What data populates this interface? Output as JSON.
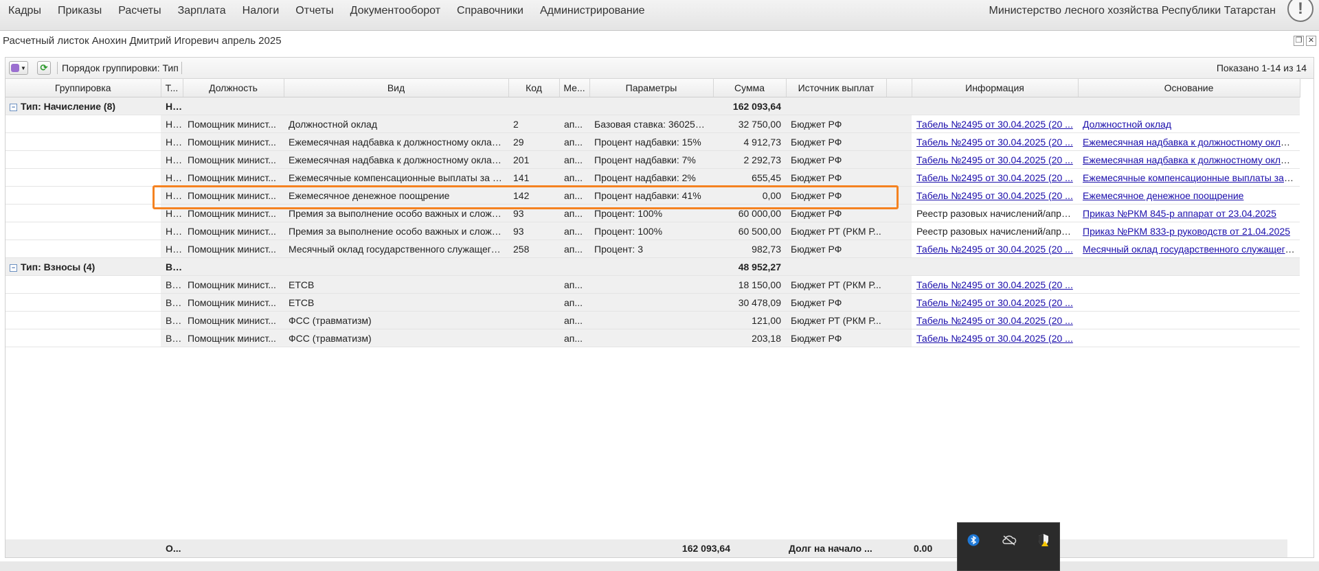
{
  "menu": [
    "Кадры",
    "Приказы",
    "Расчеты",
    "Зарплата",
    "Налоги",
    "Отчеты",
    "Документооборот",
    "Справочники",
    "Администрирование"
  ],
  "org_name": "Министерство лесного хозяйства Республики Татарстан",
  "alert_icon": "!",
  "window_title": "Расчетный листок Анохин Дмитрий Игоревич апрель 2025",
  "toolbar": {
    "group_order": "Порядок группировки:  Тип",
    "shown": "Показано 1-14 из 14"
  },
  "columns": [
    "Группировка",
    "Т...",
    "Должность",
    "Вид",
    "Код",
    "Ме...",
    "Параметры",
    "Сумма",
    "Источник выплат",
    "",
    "Информация",
    "Основание"
  ],
  "groups": [
    {
      "label": "Тип: Начисление (8)",
      "type_short": "Н...",
      "sum": "162 093,64"
    },
    {
      "label": "Тип: Взносы (4)",
      "type_short": "В...",
      "sum": "48 952,27"
    }
  ],
  "rows_accrual": [
    {
      "t": "Н...",
      "pos": "Помощник минист...",
      "kind": "Должностной оклад",
      "code": "2",
      "month": "ап...",
      "params": "Базовая ставка: 36025р...",
      "sum": "32 750,00",
      "source": "Бюджет РФ",
      "info": "Табель №2495 от 30.04.2025 (20 ...",
      "basis": "Должностной оклад"
    },
    {
      "t": "Н...",
      "pos": "Помощник минист...",
      "kind": "Ежемесячная надбавка к должностному окладу...",
      "code": "29",
      "month": "ап...",
      "params": "Процент надбавки: 15%",
      "sum": "4 912,73",
      "source": "Бюджет РФ",
      "info": "Табель №2495 от 30.04.2025 (20 ...",
      "basis": "Ежемесячная надбавка к должностному оклад..."
    },
    {
      "t": "Н...",
      "pos": "Помощник минист...",
      "kind": "Ежемесячная надбавка к должностному окладу...",
      "code": "201",
      "month": "ап...",
      "params": "Процент надбавки: 7%",
      "sum": "2 292,73",
      "source": "Бюджет РФ",
      "info": "Табель №2495 от 30.04.2025 (20 ...",
      "basis": "Ежемесячная надбавка к должностному оклад..."
    },
    {
      "t": "Н...",
      "pos": "Помощник минист...",
      "kind": "Ежемесячные компенсационные выплаты за сп...",
      "code": "141",
      "month": "ап...",
      "params": "Процент надбавки: 2%",
      "sum": "655,45",
      "source": "Бюджет РФ",
      "info": "Табель №2495 от 30.04.2025 (20 ...",
      "basis": "Ежемесячные компенсационные выплаты за с..."
    },
    {
      "t": "Н...",
      "pos": "Помощник минист...",
      "kind": "Ежемесячное денежное поощрение",
      "code": "142",
      "month": "ап...",
      "params": "Процент надбавки: 41%",
      "sum": "0,00",
      "source": "Бюджет РФ",
      "info": "Табель №2495 от 30.04.2025 (20 ...",
      "basis": "Ежемесячное денежное поощрение"
    },
    {
      "t": "Н...",
      "pos": "Помощник минист...",
      "kind": "Премия за выполнение особо важных и сложн...",
      "code": "93",
      "month": "ап...",
      "params": "Процент: 100%",
      "sum": "60 000,00",
      "source": "Бюджет РФ",
      "info": "Реестр разовых начислений/апре...",
      "basis": "Приказ №РКМ 845-р аппарат от 23.04.2025"
    },
    {
      "t": "Н...",
      "pos": "Помощник минист...",
      "kind": "Премия за выполнение особо важных и сложн...",
      "code": "93",
      "month": "ап...",
      "params": "Процент: 100%",
      "sum": "60 500,00",
      "source": "Бюджет РТ (РКМ Р...",
      "info": "Реестр разовых начислений/апре...",
      "basis": "Приказ №РКМ 833-р руководств от 21.04.2025"
    },
    {
      "t": "Н...",
      "pos": "Помощник минист...",
      "kind": "Месячный оклад государственного служащего ...",
      "code": "258",
      "month": "ап...",
      "params": "Процент: 3",
      "sum": "982,73",
      "source": "Бюджет РФ",
      "info": "Табель №2495 от 30.04.2025 (20 ...",
      "basis": "Месячный оклад государственного служащего..."
    }
  ],
  "rows_contrib": [
    {
      "t": "В...",
      "pos": "Помощник минист...",
      "kind": "ЕТСВ",
      "code": "",
      "month": "ап...",
      "params": "",
      "sum": "18 150,00",
      "source": "Бюджет РТ (РКМ Р...",
      "info": "Табель №2495 от 30.04.2025 (20 ...",
      "basis": ""
    },
    {
      "t": "В...",
      "pos": "Помощник минист...",
      "kind": "ЕТСВ",
      "code": "",
      "month": "ап...",
      "params": "",
      "sum": "30 478,09",
      "source": "Бюджет РФ",
      "info": "Табель №2495 от 30.04.2025 (20 ...",
      "basis": ""
    },
    {
      "t": "В...",
      "pos": "Помощник минист...",
      "kind": "ФСС (травматизм)",
      "code": "",
      "month": "ап...",
      "params": "",
      "sum": "121,00",
      "source": "Бюджет РТ (РКМ Р...",
      "info": "Табель №2495 от 30.04.2025 (20 ...",
      "basis": ""
    },
    {
      "t": "В...",
      "pos": "Помощник минист...",
      "kind": "ФСС (травматизм)",
      "code": "",
      "month": "ап...",
      "params": "",
      "sum": "203,18",
      "source": "Бюджет РФ",
      "info": "Табель №2495 от 30.04.2025 (20 ...",
      "basis": ""
    }
  ],
  "footer": {
    "label": "О...",
    "sum": "162 093,64",
    "debt_label": "Долг на начало ...",
    "debt_value": "0.00"
  },
  "tray_icons": [
    "bluetooth-icon",
    "cloud-offline-icon",
    "security-warning-icon"
  ]
}
